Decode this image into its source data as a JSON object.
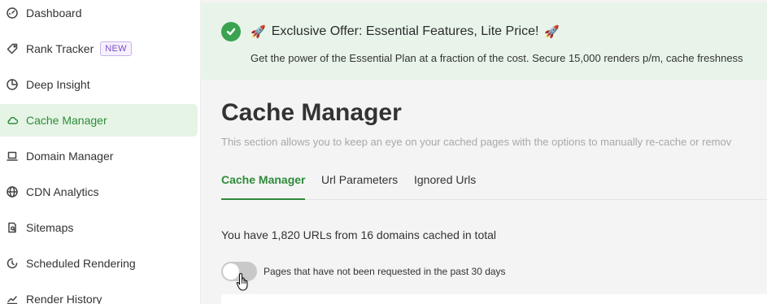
{
  "sidebar": {
    "items": [
      {
        "label": "Dashboard",
        "icon": "gauge-icon"
      },
      {
        "label": "Rank Tracker",
        "icon": "tag-icon",
        "badge": "NEW"
      },
      {
        "label": "Deep Insight",
        "icon": "pie-chart-icon"
      },
      {
        "label": "Cache Manager",
        "icon": "cloud-icon",
        "active": true
      },
      {
        "label": "Domain Manager",
        "icon": "laptop-icon"
      },
      {
        "label": "CDN Analytics",
        "icon": "globe-icon"
      },
      {
        "label": "Sitemaps",
        "icon": "sitemap-icon"
      },
      {
        "label": "Scheduled Rendering",
        "icon": "clock-icon"
      },
      {
        "label": "Render History",
        "icon": "chart-line-icon"
      }
    ]
  },
  "banner": {
    "title": "Exclusive Offer: Essential Features, Lite Price!",
    "description": "Get the power of the Essential Plan at a fraction of the cost. Secure 15,000 renders p/m, cache freshness"
  },
  "page": {
    "title": "Cache Manager",
    "description": "This section allows you to keep an eye on your cached pages with the options to manually re-cache or remov"
  },
  "tabs": [
    {
      "label": "Cache Manager",
      "active": true
    },
    {
      "label": "Url Parameters"
    },
    {
      "label": "Ignored Urls"
    }
  ],
  "summary": "You have 1,820 URLs from 16 domains cached in total",
  "filter_toggle": {
    "label": "Pages that have not been requested in the past 30 days",
    "on": false
  },
  "colors": {
    "accent": "#2e8b3a",
    "banner_bg": "#e8f4ea",
    "badge": "#7a4bc8"
  }
}
